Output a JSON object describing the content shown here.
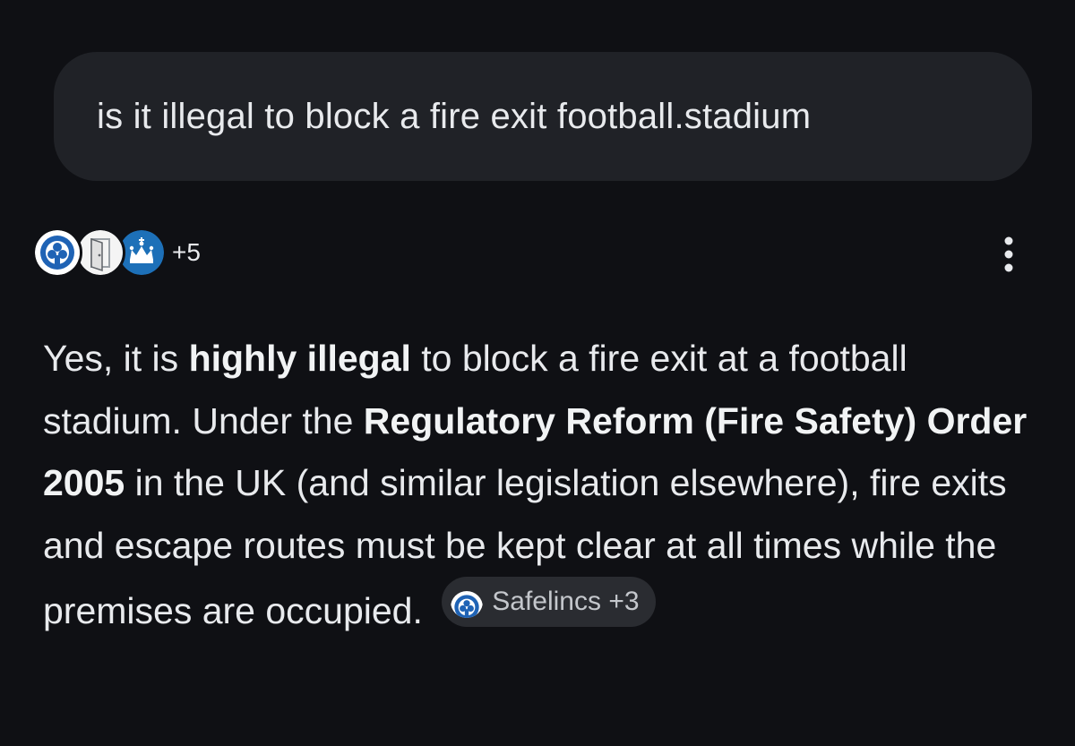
{
  "query": {
    "text": "is it illegal to block a fire exit football.stadium"
  },
  "sources": {
    "icons": [
      "safelincs-logo-icon",
      "fire-door-icon",
      "gov-crown-icon"
    ],
    "more_count": "+5"
  },
  "answer": {
    "p1": "Yes, it is ",
    "b1": "highly illegal",
    "p2": " to block a fire exit at a football stadium. Under the ",
    "b2": "Regulatory Reform (Fire Safety) Order 2005",
    "p3": " in the UK (and similar legislation elsewhere), fire exits and escape routes must be kept clear at all times while the premises are occupied. "
  },
  "citation": {
    "label": "Safelincs +3",
    "icon": "safelincs-logo-icon"
  },
  "menu": {
    "icon": "more-vert-icon"
  },
  "colors": {
    "background": "#0f1014",
    "bubble": "#202227",
    "text": "#e8eaed",
    "chip": "#2a2c31",
    "brand_blue": "#1f63b5"
  }
}
